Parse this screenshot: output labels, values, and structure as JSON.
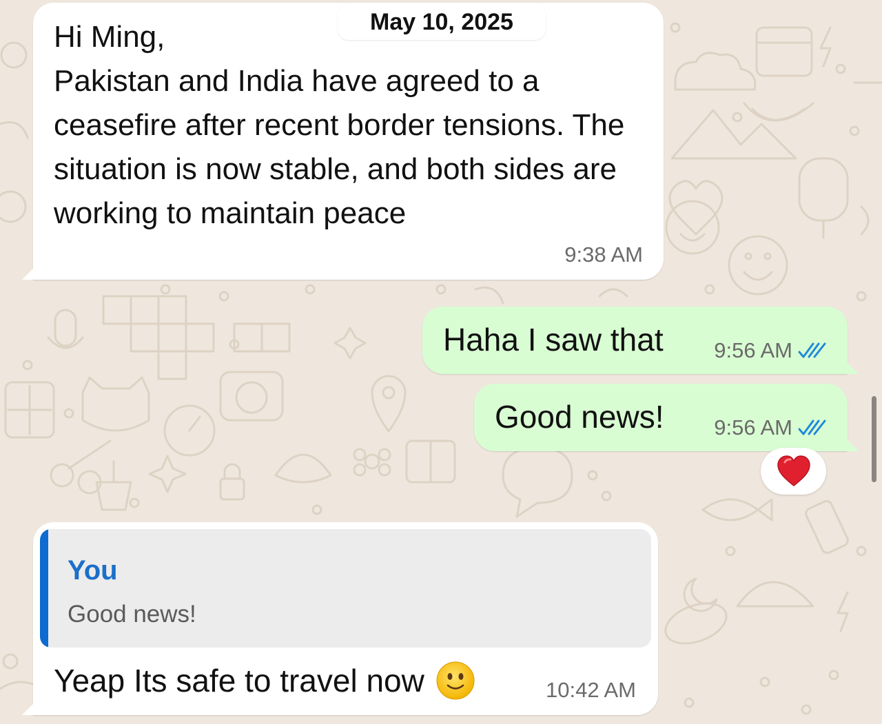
{
  "date_chip": "May 10, 2025",
  "messages": [
    {
      "direction": "incoming",
      "text": "Hi Ming,\nPakistan and India have agreed to a ceasefire after recent border tensions. The situation is now stable, and both sides are working to maintain peace",
      "time": "9:38 AM"
    },
    {
      "direction": "outgoing",
      "text": "Haha I saw that",
      "time": "9:56 AM",
      "status_icon": "double-check-read-icon"
    },
    {
      "direction": "outgoing",
      "text": "Good news!",
      "time": "9:56 AM",
      "status_icon": "double-check-read-icon",
      "reaction": "red-heart-icon"
    },
    {
      "direction": "incoming",
      "quote": {
        "author": "You",
        "text": "Good news!"
      },
      "text": "Yeap Its safe to travel now",
      "emoji": "slightly-smiling-face-icon",
      "time": "10:42 AM"
    }
  ],
  "colors": {
    "wallpaper": "#efe7dd",
    "incoming_bubble": "#ffffff",
    "outgoing_bubble": "#d9fdd3",
    "read_ticks": "#1f8bd8",
    "quote_bar": "#0d6bd1",
    "quote_author": "#1a6fc9",
    "reaction_heart": "#e0202e"
  }
}
